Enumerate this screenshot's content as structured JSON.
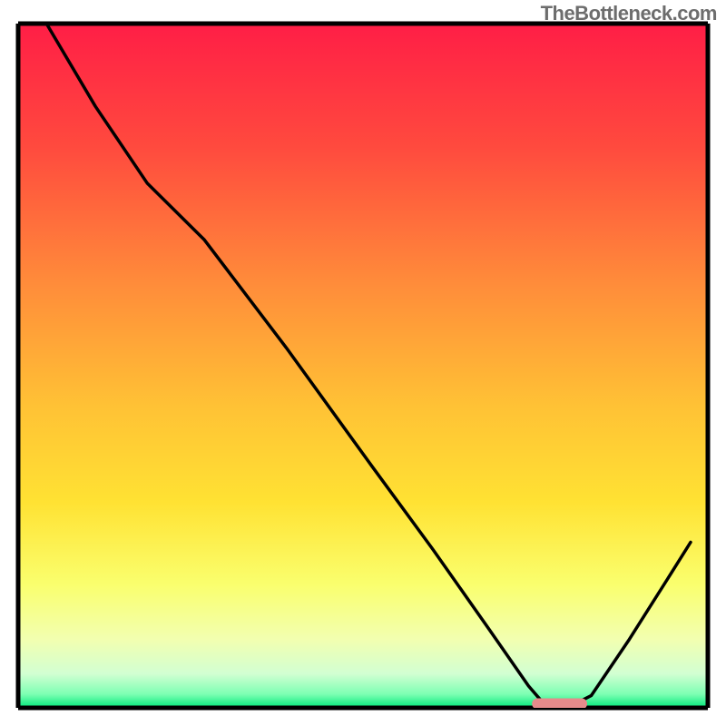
{
  "watermark": "TheBottleneck.com",
  "chart_data": {
    "type": "line",
    "title": "",
    "xlabel": "",
    "ylabel": "",
    "xlim": [
      0,
      100
    ],
    "ylim": [
      0,
      100
    ],
    "grid": false,
    "legend": false,
    "background_gradient": {
      "top_color": "#ff1e46",
      "mid_upper_color": "#ff8c3a",
      "mid_color": "#ffd733",
      "lower_color": "#faff6e",
      "near_bottom_color": "#e9ffc4",
      "bottom_color": "#00e97a"
    },
    "series": [
      {
        "name": "bottleneck-curve",
        "color": "#000000",
        "points": [
          {
            "x": 4.1,
            "y": 100.0
          },
          {
            "x": 11.2,
            "y": 87.9
          },
          {
            "x": 18.7,
            "y": 76.7
          },
          {
            "x": 27.0,
            "y": 68.4
          },
          {
            "x": 38.9,
            "y": 52.6
          },
          {
            "x": 51.3,
            "y": 35.3
          },
          {
            "x": 60.1,
            "y": 23.2
          },
          {
            "x": 68.2,
            "y": 11.6
          },
          {
            "x": 74.0,
            "y": 3.2
          },
          {
            "x": 76.3,
            "y": 0.5
          },
          {
            "x": 80.4,
            "y": 0.4
          },
          {
            "x": 83.1,
            "y": 1.8
          },
          {
            "x": 88.6,
            "y": 10.0
          },
          {
            "x": 94.2,
            "y": 18.9
          },
          {
            "x": 97.5,
            "y": 24.2
          }
        ]
      }
    ],
    "marker": {
      "name": "optimal-range-marker",
      "color": "#e78b8b",
      "shape": "rounded-rect",
      "x_start": 74.5,
      "x_end": 82.5,
      "y": 0.6
    },
    "plot_frame": {
      "left_pct": 2.5,
      "right_pct": 97.5,
      "top_pct": 3.3,
      "bottom_pct": 97.5,
      "stroke": "#000000",
      "stroke_width": 5
    }
  }
}
